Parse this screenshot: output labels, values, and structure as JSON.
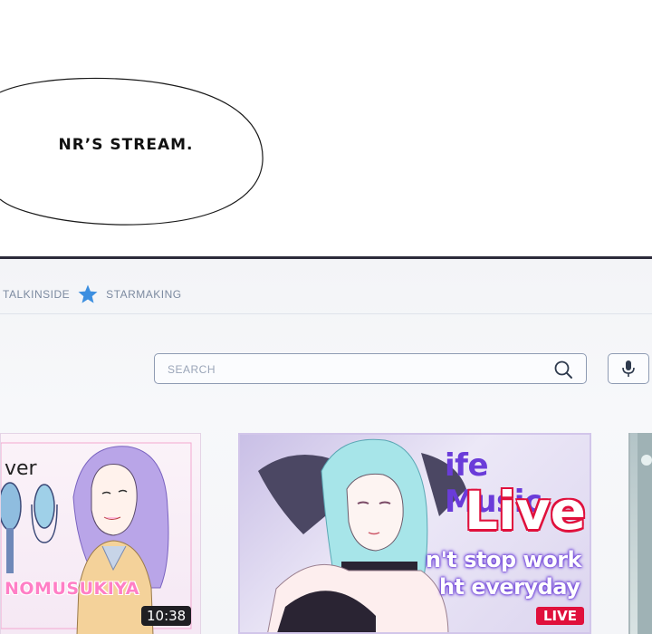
{
  "caption": {
    "text": "NR’S STREAM."
  },
  "nav": {
    "item_1": "TALKINSIDE",
    "star_icon": "star-icon",
    "item_2": "STARMAKING"
  },
  "search": {
    "placeholder": "SEARCH",
    "icon": "search-icon"
  },
  "mic": {
    "icon": "microphone-icon"
  },
  "videos": [
    {
      "text_fragment": "ver",
      "channel": "NOMUSUKIYA",
      "duration": "10:38"
    },
    {
      "title_line_1": "ife Music",
      "title_line_2": "Live",
      "line_3": "n't stop work",
      "line_4": "ht everyday",
      "badge": "LIVE"
    },
    {}
  ],
  "colors": {
    "accent": "#3d8fe0",
    "live_red": "#e0103c",
    "title_purple": "#6a3cd9",
    "channel_pink": "#ff7fc6",
    "panel_border": "#2b2a3a"
  }
}
